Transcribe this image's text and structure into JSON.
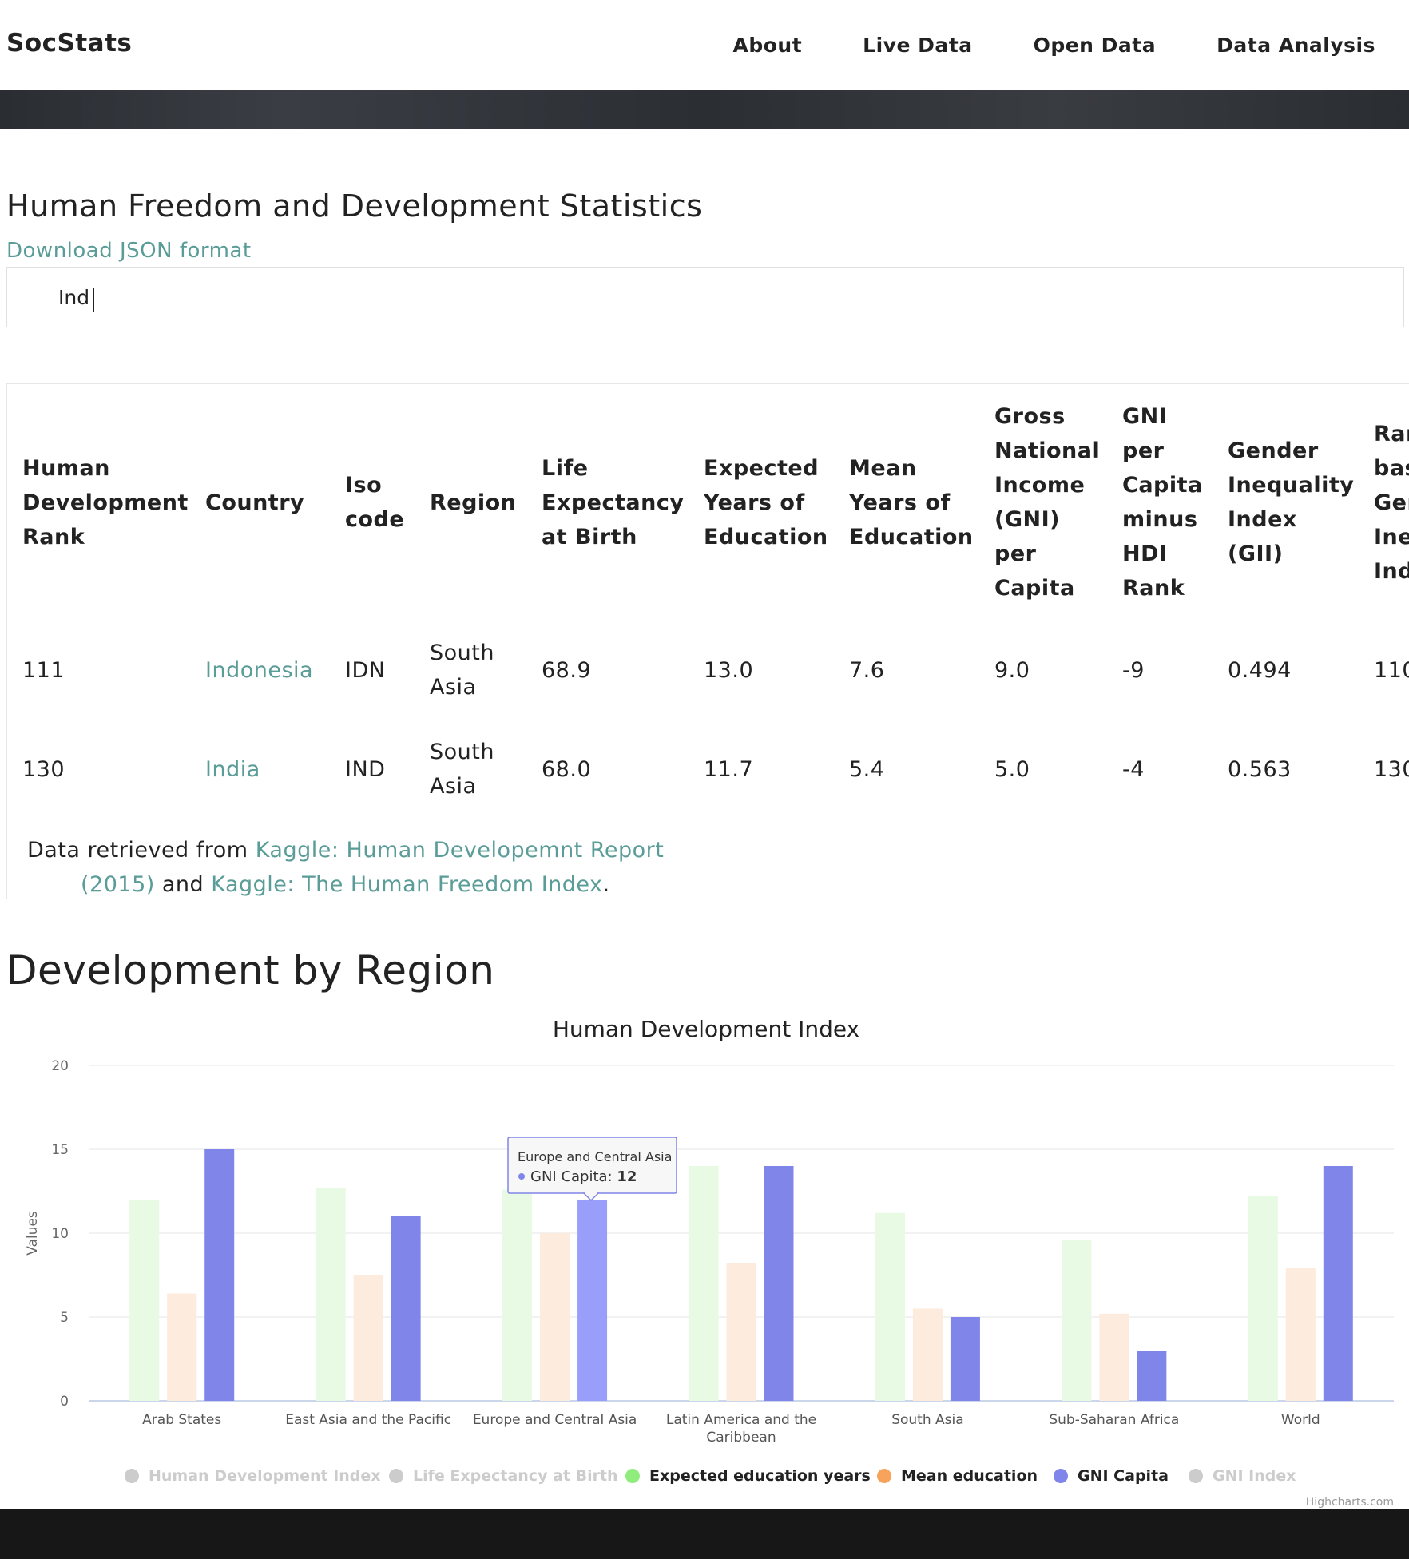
{
  "nav": {
    "brand": "SocStats",
    "links": [
      "About",
      "Live Data",
      "Open Data",
      "Data Analysis"
    ]
  },
  "stats": {
    "title": "Human Freedom and Development Statistics",
    "download_link": "Download JSON format",
    "search_value": "Ind",
    "columns": [
      [
        "Human",
        "Development",
        "Rank"
      ],
      [
        "Country"
      ],
      [
        "Iso",
        "code"
      ],
      [
        "Region"
      ],
      [
        "Life",
        "Expectancy",
        "at Birth"
      ],
      [
        "Expected",
        "Years of",
        "Education"
      ],
      [
        "Mean",
        "Years of",
        "Education"
      ],
      [
        "Gross",
        "National",
        "Income",
        "(GNI)",
        "per",
        "Capita"
      ],
      [
        "GNI",
        "per",
        "Capita",
        "minus",
        "HDI",
        "Rank"
      ],
      [
        "Gender",
        "Inequality",
        "Index",
        "(GII)"
      ],
      [
        "Ran",
        "bas",
        "Gen",
        "Ine",
        "Ind"
      ]
    ],
    "rows": [
      [
        "111",
        "Indonesia",
        "IDN",
        "South Asia",
        "68.9",
        "13.0",
        "7.6",
        "9.0",
        "-9",
        "0.494",
        "110"
      ],
      [
        "130",
        "India",
        "IND",
        "South Asia",
        "68.0",
        "11.7",
        "5.4",
        "5.0",
        "-4",
        "0.563",
        "130"
      ]
    ],
    "source": {
      "prefix": "Data retrieved from ",
      "link1a": "Kaggle: Human Developemnt Report",
      "link1b": "(2015)",
      "middle": " and ",
      "link2": "Kaggle: The Human Freedom Index",
      "suffix": "."
    }
  },
  "region_section": {
    "title": "Development by Region"
  },
  "chart_data": {
    "type": "bar",
    "title": "Human Development Index",
    "ylabel": "Values",
    "ylim": [
      0,
      20
    ],
    "yticks": [
      0,
      5,
      10,
      15,
      20
    ],
    "categories": [
      "Arab States",
      "East Asia and the Pacific",
      "Europe and Central Asia",
      "Latin America and the Caribbean",
      "South Asia",
      "Sub-Saharan Africa",
      "World"
    ],
    "series": [
      {
        "name": "Human Development Index",
        "visible": false,
        "color": "#cccccc",
        "values": []
      },
      {
        "name": "Life Expectancy at Birth",
        "visible": false,
        "color": "#cccccc",
        "values": []
      },
      {
        "name": "Expected education years",
        "visible": true,
        "color": "#90ed7d",
        "values": [
          12,
          12.7,
          12.6,
          14,
          11.2,
          9.6,
          12.2
        ]
      },
      {
        "name": "Mean education",
        "visible": true,
        "color": "#f7a35c",
        "values": [
          6.4,
          7.5,
          10,
          8.2,
          5.5,
          5.2,
          7.9
        ]
      },
      {
        "name": "GNI Capita",
        "visible": true,
        "color": "#8085e9",
        "values": [
          15,
          11,
          12,
          14,
          5,
          3,
          14
        ]
      },
      {
        "name": "GNI Index",
        "visible": false,
        "color": "#cccccc",
        "values": []
      }
    ],
    "grid": true,
    "legend": "bottom-center",
    "tooltip": {
      "category": "Europe and Central Asia",
      "series": "GNI Capita",
      "label": "GNI Capita: ",
      "value": "12"
    },
    "credits": "Highcharts.com"
  }
}
